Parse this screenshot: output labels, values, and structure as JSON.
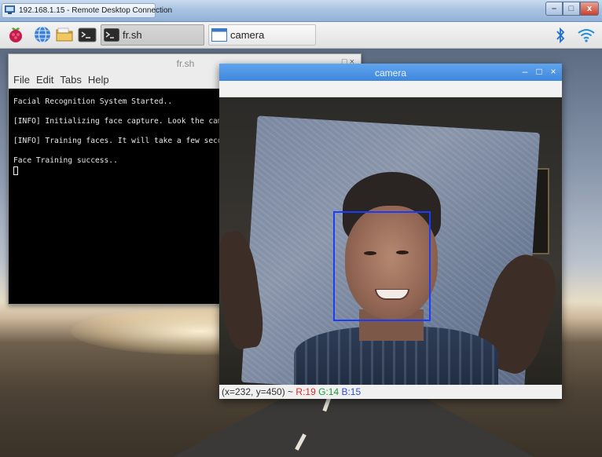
{
  "rdp": {
    "title": "192.168.1.15 - Remote Desktop Connection",
    "controls": {
      "minimize": "–",
      "maximize": "□",
      "close": "x"
    }
  },
  "panel": {
    "tasks": [
      {
        "label": "fr.sh",
        "icon": "terminal-icon"
      },
      {
        "label": "camera",
        "icon": "window-icon"
      }
    ],
    "tray": {
      "bluetooth_icon": "bluetooth-icon",
      "wifi_icon": "wifi-icon"
    }
  },
  "terminal": {
    "title": "fr.sh",
    "title_controls": "□ ×",
    "menu": [
      "File",
      "Edit",
      "Tabs",
      "Help"
    ],
    "lines": [
      "Facial Recognition System Started..",
      "[INFO] Initializing face capture. Look the came",
      "[INFO] Training faces. It will take a few secon",
      "Face Training success.."
    ]
  },
  "camera": {
    "title": "camera",
    "controls": {
      "minimize": "–",
      "maximize": "□",
      "close": "×"
    },
    "status": {
      "coords": "(x=232, y=450) ~",
      "r": "R:19",
      "g": "G:14",
      "b": "B:15"
    },
    "detection_color": "#1a3cff"
  },
  "colors": {
    "camera_titlebar": "#4a90e2",
    "terminal_bg": "#000000",
    "face_box": "#1a3cff"
  }
}
